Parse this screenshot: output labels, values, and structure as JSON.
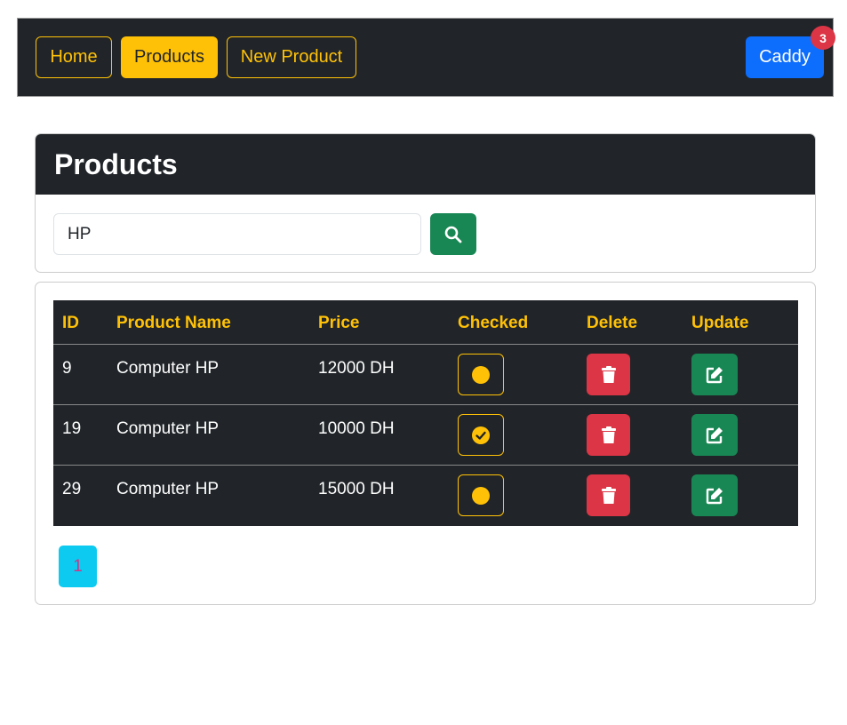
{
  "navbar": {
    "home_label": "Home",
    "products_label": "Products",
    "new_product_label": "New Product",
    "caddy_label": "Caddy",
    "caddy_count": "3"
  },
  "products_card": {
    "title": "Products",
    "search": {
      "value": "HP",
      "placeholder": ""
    },
    "search_icon": "search-icon"
  },
  "table": {
    "headers": [
      "ID",
      "Product Name",
      "Price",
      "Checked",
      "Delete",
      "Update"
    ],
    "rows": [
      {
        "id": "9",
        "name": "Computer HP",
        "price": "12000 DH",
        "checked": false
      },
      {
        "id": "19",
        "name": "Computer HP",
        "price": "10000 DH",
        "checked": true
      },
      {
        "id": "29",
        "name": "Computer HP",
        "price": "15000 DH",
        "checked": false
      }
    ]
  },
  "pagination": {
    "pages": [
      "1"
    ],
    "current": "1"
  },
  "colors": {
    "dark": "#212529",
    "warning": "#ffc107",
    "primary": "#0d6efd",
    "danger": "#dc3545",
    "success": "#198754",
    "info": "#0dcaf0"
  }
}
